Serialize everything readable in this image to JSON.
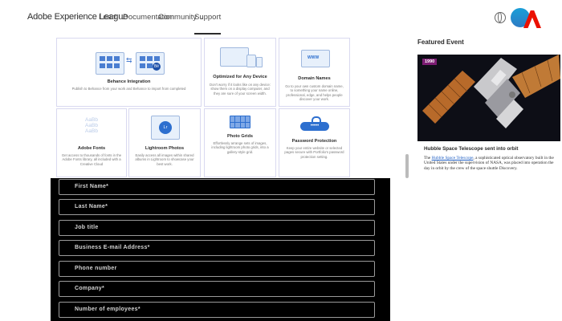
{
  "header": {
    "brand": "Adobe Experience League",
    "nav": [
      {
        "label": "Learn",
        "has_chevron": true
      },
      {
        "label": "Documentation",
        "has_chevron": false
      },
      {
        "label": "Community",
        "has_chevron": true
      },
      {
        "label": "Support",
        "has_chevron": false,
        "active": true
      }
    ],
    "icons": [
      "globe-icon",
      "avatar",
      "adobe-logo"
    ]
  },
  "features": [
    {
      "title": "Behance Integration",
      "desc": "Publish to Behance from your work and Behance to import from completed"
    },
    {
      "title": "Optimized for Any Device",
      "desc": "Don't worry if it looks like on any device: show them on a display computer, and they are sure of your screen width."
    },
    {
      "title": "Domain Names",
      "desc": "Go to your own custom domain name, to something your name online, professional, edge, and helps people discover your work.",
      "badge": "WWW"
    },
    {
      "title": "Adobe Fonts",
      "desc": "Get access to thousands of fonts in the Adobe Fonts library, all included with a Creative Cloud",
      "font_sample": "AaBb"
    },
    {
      "title": "Lightroom Photos",
      "desc": "Easily access all images within shared albums in Lightroom to showcase your best work.",
      "badge": "Lr"
    },
    {
      "title": "Photo Grids",
      "desc": "Effortlessly arrange sets of images, including lightroom photo grids, into a gallery-style grid."
    },
    {
      "title": "Password Protection",
      "desc": "Keep your entire website or selected pages secure with Portfolio's password protection setting.",
      "badge": "•••••"
    }
  ],
  "featured": {
    "heading": "Featured Event",
    "year": "1990",
    "title": "Hubble Space Telescope sent into orbit",
    "desc_pre": "The ",
    "desc_link": "Hubble Space Telescope",
    "desc_post": ", a sophisticated optical observatory built in the United States under the supervision of NASA, was placed into operation the day in orbit by the crew of the space shuttle Discovery."
  },
  "form": {
    "fields": [
      "First Name*",
      "Last Name*",
      "Job title",
      "Business E-mail Address*",
      "Phone number",
      "Company*",
      "Number of employees*"
    ]
  },
  "colors": {
    "accent_blue": "#2d6fcf",
    "adobe_red": "#eb1000",
    "year_badge": "#7c1c73"
  }
}
